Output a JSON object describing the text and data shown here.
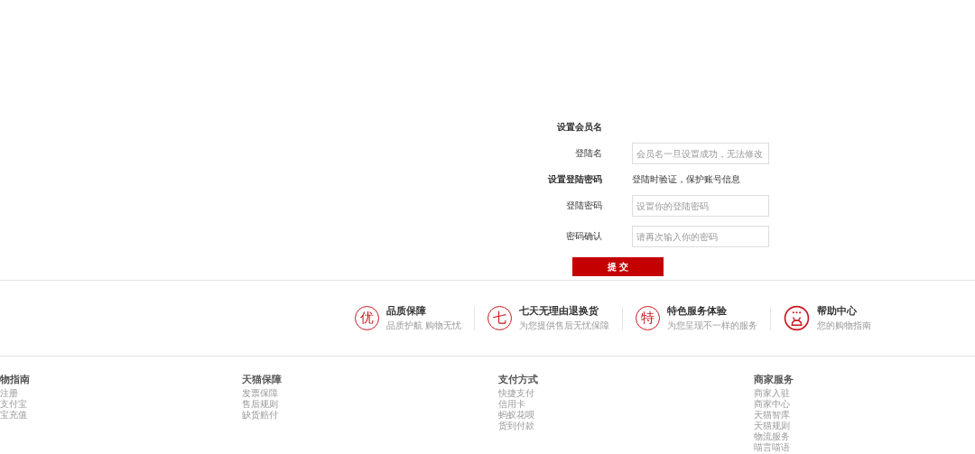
{
  "form": {
    "rows": [
      {
        "kind": "heading",
        "label": "设置会员名"
      },
      {
        "kind": "field",
        "label": "登陆名",
        "placeholder": "会员名一旦设置成功，无法修改"
      },
      {
        "kind": "note",
        "label": "设置登陆密码",
        "note": "登陆时验证，保护账号信息"
      },
      {
        "kind": "field",
        "label": "登陆密码",
        "placeholder": "设置你的登陆密码"
      },
      {
        "kind": "field",
        "label": "密码确认",
        "placeholder": "请再次输入你的密码"
      }
    ],
    "submit": "提 交"
  },
  "services": [
    {
      "kind": "glyph",
      "glyph": "优",
      "title": "品质保障",
      "subtitle": "品质护航 购物无忧"
    },
    {
      "kind": "glyph",
      "glyph": "七",
      "title": "七天无理由退换货",
      "subtitle": "为您提供售后无忧保障"
    },
    {
      "kind": "glyph",
      "glyph": "特",
      "title": "特色服务体验",
      "subtitle": "为您呈现不一样的服务"
    },
    {
      "kind": "person",
      "title": "帮助中心",
      "subtitle": "您的购物指南"
    }
  ],
  "footer_columns": [
    {
      "title": "物指南",
      "links": [
        "注册",
        "支付宝",
        "宝充值"
      ]
    },
    {
      "title": "天猫保障",
      "links": [
        "发票保障",
        "售后规则",
        "缺货赔付"
      ]
    },
    {
      "title": "支付方式",
      "links": [
        "快捷支付",
        "信用卡",
        "蚂蚁花呗",
        "货到付款"
      ]
    },
    {
      "title": "商家服务",
      "links": [
        "商家入驻",
        "商家中心",
        "天猫智库",
        "天猫规则",
        "物流服务",
        "喵言喵语"
      ]
    }
  ]
}
